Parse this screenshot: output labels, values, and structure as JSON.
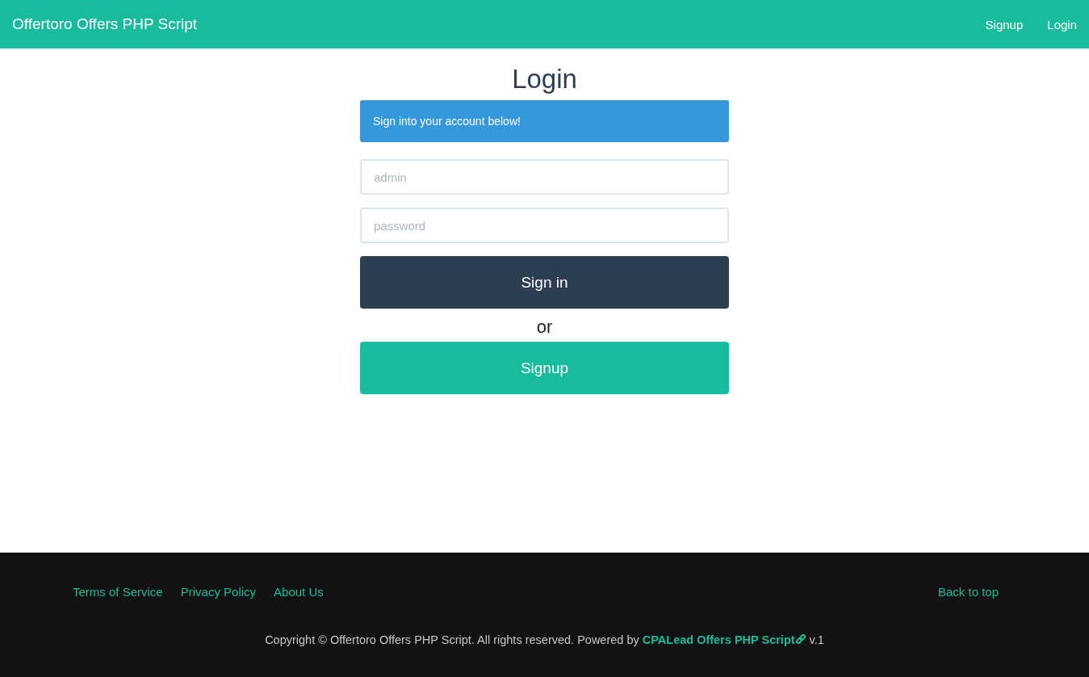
{
  "navbar": {
    "brand": "Offertoro Offers PHP Script",
    "links": [
      "Signup",
      "Login"
    ]
  },
  "login": {
    "title": "Login",
    "alert": "Sign into your account below!",
    "fields": [
      {
        "placeholder": "admin"
      },
      {
        "placeholder": "password"
      }
    ],
    "sign_in_button": "Sign in",
    "separator": "or",
    "signup_button": "Signup"
  },
  "footer": {
    "links": [
      "Terms of Service",
      "Privacy Policy",
      "About Us"
    ],
    "back_to_top": "Back to top",
    "copyright": {
      "text": "Copyright © Offertoro Offers PHP Script. All rights reserved. Powered by",
      "link": "CPALead Offers PHP Script",
      "version": "v.1"
    }
  }
}
